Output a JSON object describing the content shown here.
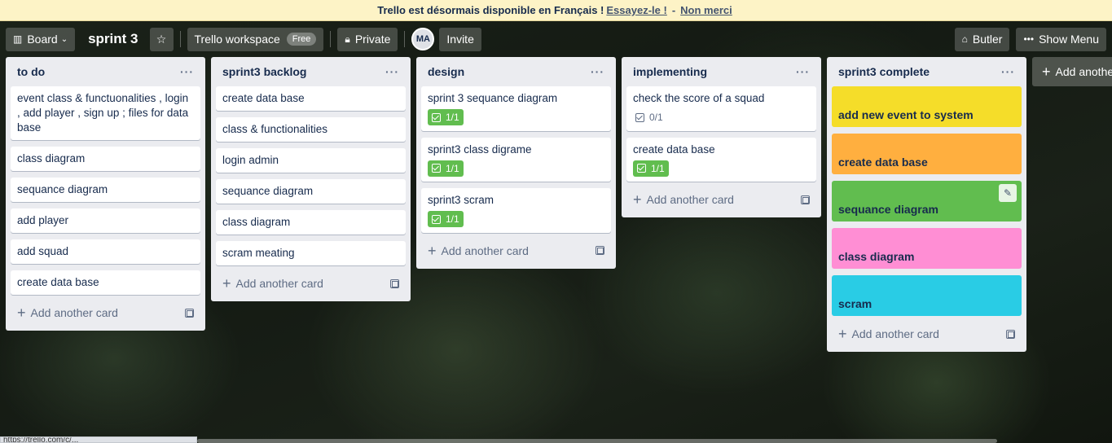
{
  "banner": {
    "message": "Trello est désormais disponible en Français !",
    "try_link": "Essayez-le !",
    "separator": "-",
    "dismiss_link": "Non merci"
  },
  "header": {
    "board_switcher": "Board",
    "board_title": "sprint 3",
    "workspace": "Trello workspace",
    "workspace_badge": "Free",
    "visibility": "Private",
    "avatar_initials": "MA",
    "invite": "Invite",
    "butler": "Butler",
    "show_menu": "Show Menu"
  },
  "lists": [
    {
      "title": "to do",
      "cards": [
        {
          "text": "event class & functuonalities , login , add player , sign up ; files for data base"
        },
        {
          "text": "class diagram"
        },
        {
          "text": "sequance diagram"
        },
        {
          "text": "add player"
        },
        {
          "text": "add squad"
        },
        {
          "text": "create data base"
        }
      ],
      "add_card": "Add another card"
    },
    {
      "title": "sprint3 backlog",
      "cards": [
        {
          "text": "create data base"
        },
        {
          "text": "class & functionalities"
        },
        {
          "text": "login admin"
        },
        {
          "text": "sequance diagram"
        },
        {
          "text": "class diagram"
        },
        {
          "text": "scram meating"
        }
      ],
      "add_card": "Add another card"
    },
    {
      "title": "design",
      "cards": [
        {
          "text": "sprint 3 sequance diagram",
          "checklist": "1/1"
        },
        {
          "text": "sprint3 class digrame",
          "checklist": "1/1"
        },
        {
          "text": "sprint3 scram",
          "checklist": "1/1"
        }
      ],
      "add_card": "Add another card"
    },
    {
      "title": "implementing",
      "cards": [
        {
          "text": "check the score of a squad",
          "checklist": "0/1"
        },
        {
          "text": "create data base",
          "checklist": "1/1"
        }
      ],
      "add_card": "Add another card"
    },
    {
      "title": "sprint3 complete",
      "cards": [
        {
          "text": "add new event to system",
          "color": "#f5dd29"
        },
        {
          "text": "create data base",
          "color": "#ffaf3f"
        },
        {
          "text": "sequance diagram",
          "color": "#61bd4f"
        },
        {
          "text": "class diagram",
          "color": "#ff8ed4"
        },
        {
          "text": "scram",
          "color": "#29cce5"
        }
      ],
      "add_card": "Add another card"
    }
  ],
  "add_list": "Add another list",
  "status_url": "https://trello.com/c/..."
}
